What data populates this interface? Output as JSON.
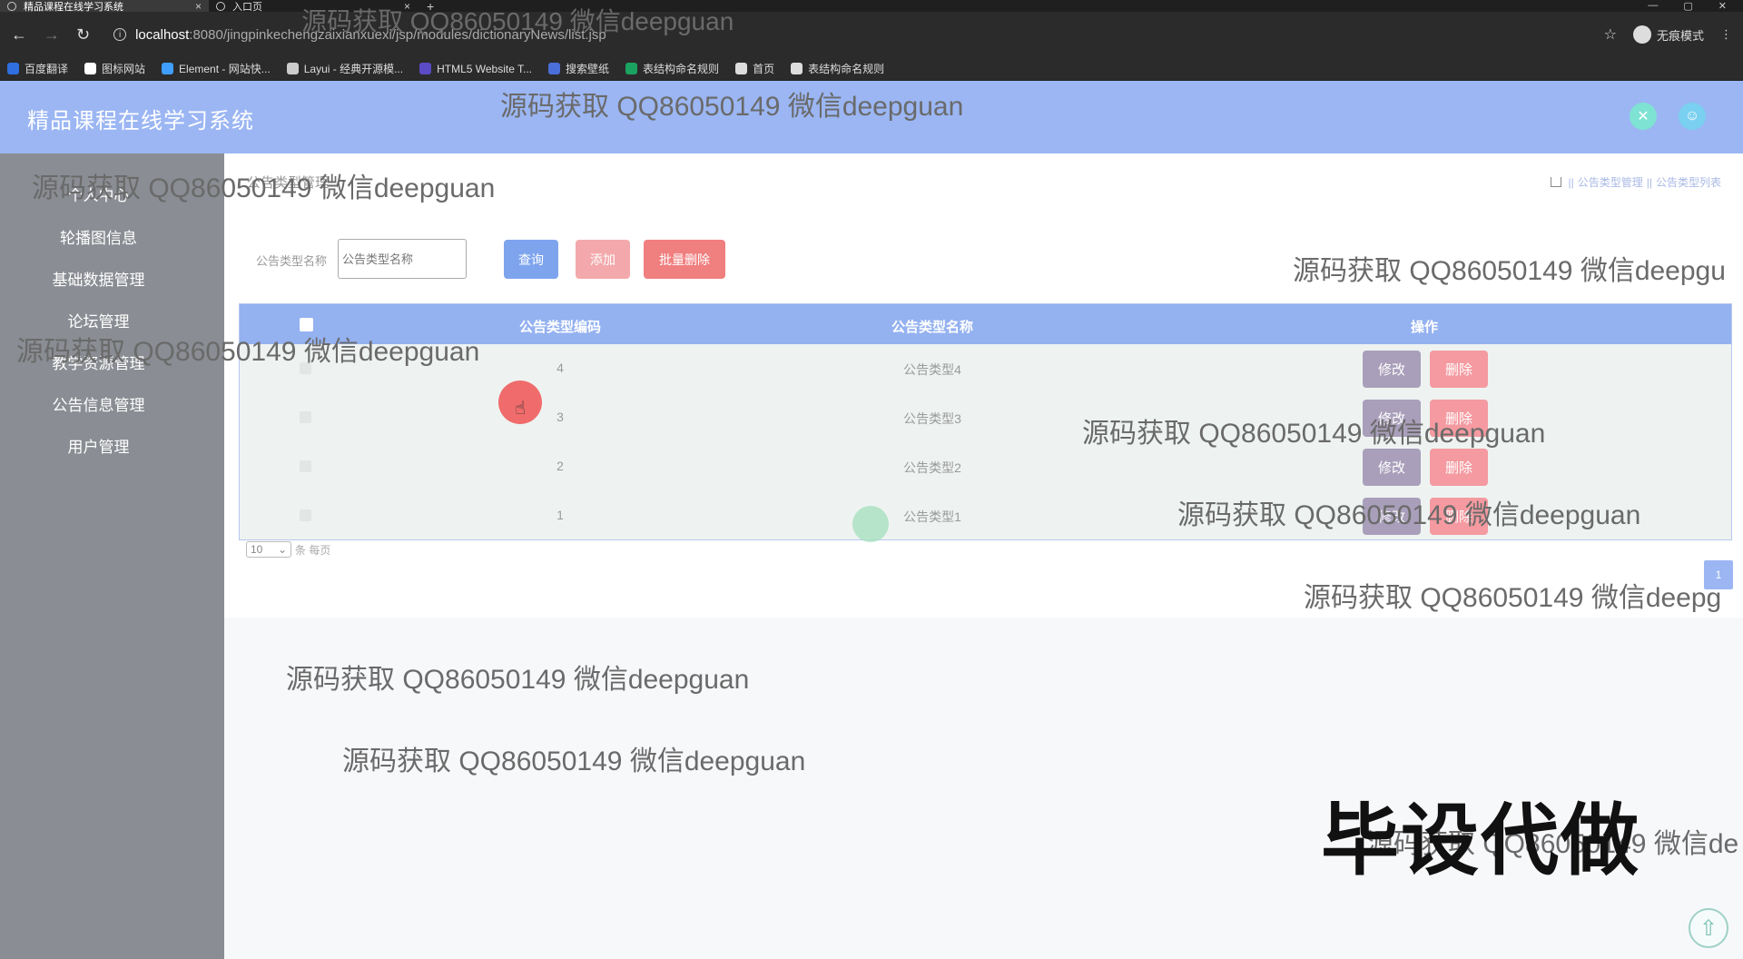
{
  "browser": {
    "tabs": [
      {
        "title": "精品课程在线学习系统",
        "active": true
      },
      {
        "title": "入口页",
        "active": false
      }
    ],
    "url_host": "localhost",
    "url_path": ":8080/jingpinkechengzaixianxuexi/jsp/modules/dictionaryNews/list.jsp",
    "profile_label": "无痕模式",
    "bookmarks": [
      {
        "label": "百度翻译",
        "color": "#2f6fe0"
      },
      {
        "label": "图标网站",
        "color": "#ffffff"
      },
      {
        "label": "Element - 网站快...",
        "color": "#409eff"
      },
      {
        "label": "Layui - 经典开源模...",
        "color": "#cccccc"
      },
      {
        "label": "HTML5 Website T...",
        "color": "#5b4bc4"
      },
      {
        "label": "搜索壁纸",
        "color": "#4a6fd8"
      },
      {
        "label": "表结构命名规则",
        "color": "#1aa260"
      },
      {
        "label": "首页",
        "color": "#dddddd"
      },
      {
        "label": "表结构命名规则",
        "color": "#dddddd"
      }
    ]
  },
  "app": {
    "title": "精品课程在线学习系统",
    "accent_color": "#9bb6f3"
  },
  "sidebar": {
    "items": [
      {
        "label": "个人中心"
      },
      {
        "label": "轮播图信息"
      },
      {
        "label": "基础数据管理"
      },
      {
        "label": "论坛管理"
      },
      {
        "label": "教学资源管理"
      },
      {
        "label": "公告信息管理"
      },
      {
        "label": "用户管理"
      }
    ]
  },
  "main": {
    "heading": "公告类型管理",
    "breadcrumb": [
      "公告类型管理",
      "公告类型列表"
    ],
    "search": {
      "label": "公告类型名称",
      "placeholder": "公告类型名称",
      "query_label": "查询",
      "add_label": "添加",
      "batch_delete_label": "批量删除"
    },
    "table": {
      "columns": [
        "公告类型编码",
        "公告类型名称",
        "操作"
      ],
      "rows": [
        {
          "code": "4",
          "name": "公告类型4"
        },
        {
          "code": "3",
          "name": "公告类型3"
        },
        {
          "code": "2",
          "name": "公告类型2"
        },
        {
          "code": "1",
          "name": "公告类型1"
        }
      ],
      "edit_label": "修改",
      "delete_label": "删除"
    },
    "pagination": {
      "page_size": "10",
      "page_size_suffix": "条 每页",
      "current_page": "1"
    }
  },
  "watermarks": {
    "text": "源码获取 QQ86050149 微信deepguan",
    "partial_1": "源码获取 QQ86050149 微信deepgu",
    "partial_2": "源码获取 QQ86050149 微信deepg",
    "partial_3": "源码获取 QQ86050149 微信de",
    "big_stamp": "毕设代做"
  }
}
